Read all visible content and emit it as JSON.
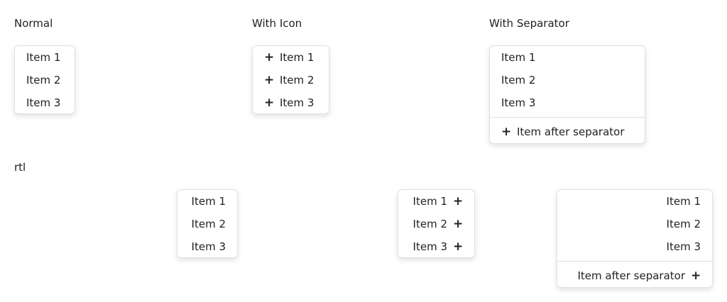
{
  "sections": {
    "normal": "Normal",
    "with_icon": "With Icon",
    "with_separator": "With Separator",
    "rtl": "rtl"
  },
  "menus": {
    "items": [
      "Item 1",
      "Item 2",
      "Item 3"
    ],
    "after_separator": "Item after separator"
  },
  "icons": {
    "item_icon": "plus-icon",
    "glyph": "+"
  }
}
